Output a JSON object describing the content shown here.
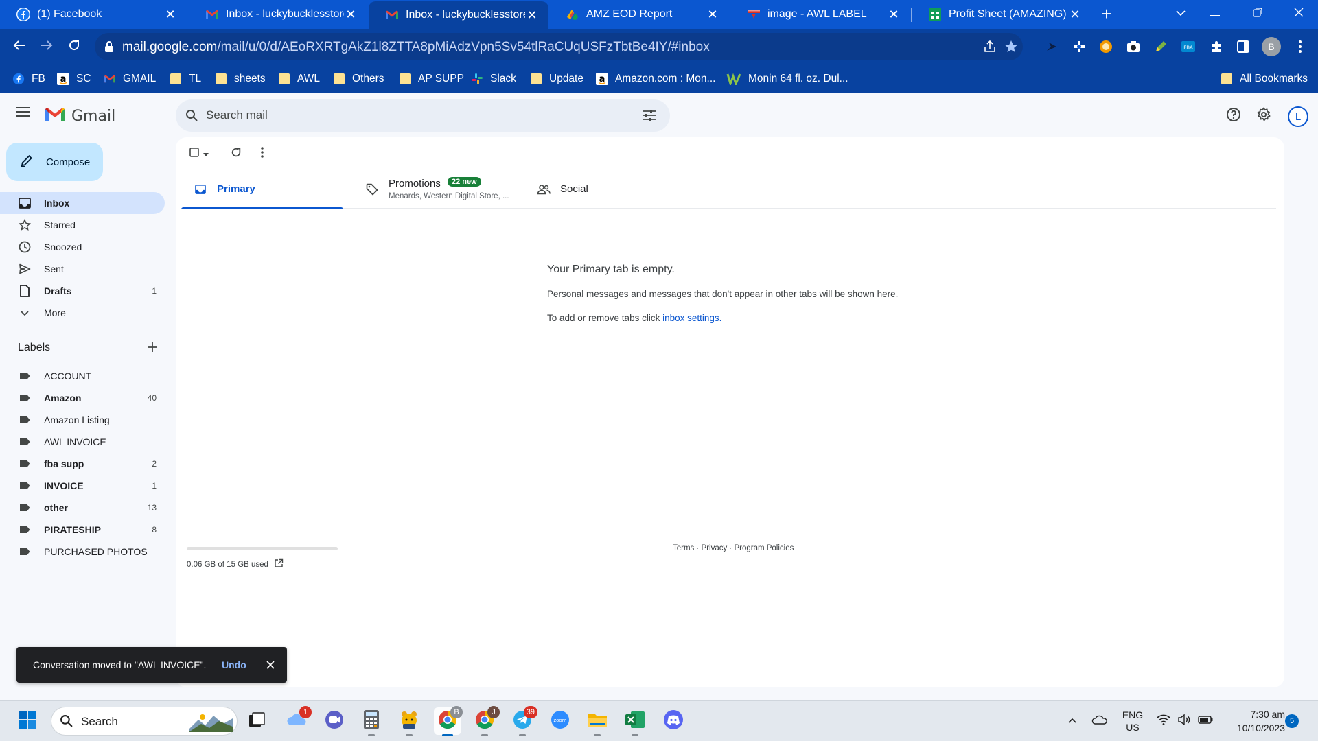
{
  "browser": {
    "tabs": [
      {
        "title": "(1) Facebook",
        "icon": "facebook-icon"
      },
      {
        "title": "Inbox - luckybucklesstore@",
        "icon": "gmail-icon"
      },
      {
        "title": "Inbox - luckybucklesstore@",
        "icon": "gmail-icon",
        "active": true
      },
      {
        "title": "AMZ EOD Report",
        "icon": "report-icon"
      },
      {
        "title": "image - AWL LABEL",
        "icon": "awl-icon"
      },
      {
        "title": "Profit Sheet (AMAZING) - (",
        "icon": "sheets-icon"
      }
    ],
    "new_tab": "+",
    "url_host": "mail.google.com",
    "url_path": "/mail/u/0/d/AEoRXRTgAkZ1l8ZTTA8pMiAdzVpn5Sv54tlRaCUqUSFzTbtBe4IY/#inbox",
    "profile_initial": "B"
  },
  "bookmarks": {
    "items": [
      {
        "label": "FB",
        "icon": "facebook-icon"
      },
      {
        "label": "SC",
        "icon": "amazon-icon"
      },
      {
        "label": "GMAIL",
        "icon": "gmail-icon"
      },
      {
        "label": "TL",
        "icon": "folder-icon"
      },
      {
        "label": "sheets",
        "icon": "folder-icon"
      },
      {
        "label": "AWL",
        "icon": "folder-icon"
      },
      {
        "label": "Others",
        "icon": "folder-icon"
      },
      {
        "label": "AP SUPP",
        "icon": "folder-icon"
      },
      {
        "label": "Slack",
        "icon": "slack-icon"
      },
      {
        "label": "Update",
        "icon": "folder-icon"
      },
      {
        "label": "Amazon.com : Mon...",
        "icon": "amazon-icon"
      },
      {
        "label": "Monin 64 fl. oz. Dul...",
        "icon": "monin-icon"
      }
    ],
    "all_bookmarks": "All Bookmarks"
  },
  "gmail": {
    "app_name": "Gmail",
    "search_placeholder": "Search mail",
    "account_initial": "L",
    "compose_label": "Compose",
    "nav": [
      {
        "label": "Inbox",
        "count": "",
        "active": true,
        "bold": true
      },
      {
        "label": "Starred",
        "count": ""
      },
      {
        "label": "Snoozed",
        "count": ""
      },
      {
        "label": "Sent",
        "count": ""
      },
      {
        "label": "Drafts",
        "count": "1",
        "bold": true
      },
      {
        "label": "More",
        "count": ""
      }
    ],
    "labels_title": "Labels",
    "labels": [
      {
        "label": "ACCOUNT",
        "count": "",
        "bold": false
      },
      {
        "label": "Amazon",
        "count": "40",
        "bold": true
      },
      {
        "label": "Amazon Listing",
        "count": "",
        "bold": false
      },
      {
        "label": "AWL INVOICE",
        "count": "",
        "bold": false
      },
      {
        "label": "fba supp",
        "count": "2",
        "bold": true
      },
      {
        "label": "INVOICE",
        "count": "1",
        "bold": true
      },
      {
        "label": "other",
        "count": "13",
        "bold": true
      },
      {
        "label": "PIRATESHIP",
        "count": "8",
        "bold": true
      },
      {
        "label": "PURCHASED PHOTOS",
        "count": "",
        "bold": false
      }
    ],
    "category_tabs": [
      {
        "name": "Primary"
      },
      {
        "name": "Promotions",
        "badge": "22 new",
        "sub": "Menards, Western Digital Store, ..."
      },
      {
        "name": "Social"
      }
    ],
    "empty": {
      "title": "Your Primary tab is empty.",
      "line1": "Personal messages and messages that don't appear in other tabs will be shown here.",
      "line2_prefix": "To add or remove tabs click ",
      "line2_link": "inbox settings",
      "line2_suffix": "."
    },
    "storage": {
      "text": "0.06 GB of 15 GB used",
      "fraction": 0.004
    },
    "footer": "Terms · Privacy · Program Policies",
    "snackbar": {
      "message": "Conversation moved to \"AWL INVOICE\".",
      "action": "Undo"
    }
  },
  "taskbar": {
    "search_placeholder": "Search",
    "weather_badge": "1",
    "telegram_badge": "39",
    "language": "ENG",
    "region": "US",
    "time": "7:30 am",
    "date": "10/10/2023",
    "notifications": "5"
  }
}
